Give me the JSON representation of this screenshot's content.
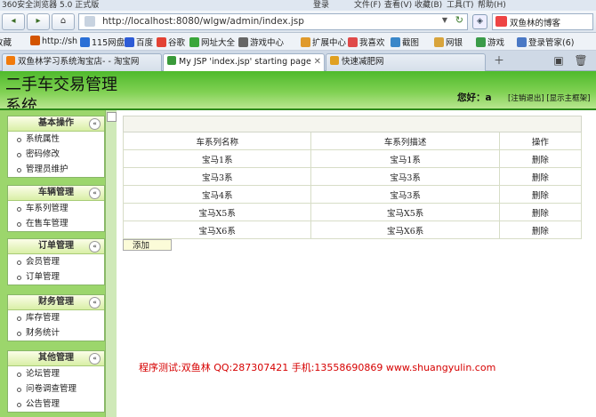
{
  "browser": {
    "window_title": "360安全浏览器 5.0 正式版",
    "menu": [
      "登录",
      "文件(F)",
      "查看(V)",
      "收藏(B)",
      "工具(T)",
      "帮助(H)"
    ],
    "address": "http://localhost:8080/wlgw/admin/index.jsp",
    "search_label": "双鱼林的博客",
    "nav": {
      "back": "◂",
      "forward": "▸",
      "home": "⌂"
    },
    "favorites": [
      {
        "label": "收藏",
        "color": "#e8b030"
      },
      {
        "label": "http://sh",
        "color": "#d35400"
      },
      {
        "label": "115网盘",
        "color": "#2a6fd6"
      },
      {
        "label": "百度",
        "color": "#2d5bd6"
      },
      {
        "label": "谷歌",
        "color": "#e34234"
      },
      {
        "label": "网址大全",
        "color": "#3aa63a"
      },
      {
        "label": "游戏中心",
        "color": "#666"
      },
      {
        "label": "扩展中心",
        "color": "#e09a2c"
      },
      {
        "label": "我喜欢",
        "color": "#e04a4a"
      },
      {
        "label": "截图",
        "color": "#3a87c9"
      },
      {
        "label": "网银",
        "color": "#d8a43c"
      },
      {
        "label": "游戏",
        "color": "#3b9b49"
      },
      {
        "label": "登录管家(6)",
        "color": "#4a78c5"
      }
    ],
    "tabs": [
      {
        "label": "双鱼林学习系统淘宝店- - 淘宝网",
        "color": "#f17a0b",
        "active": false
      },
      {
        "label": "My JSP 'index.jsp' starting page",
        "color": "#3a9a3a",
        "active": true
      },
      {
        "label": "快速减肥网",
        "color": "#e0a020",
        "active": false
      }
    ]
  },
  "header": {
    "title": "二手车交易管理系统",
    "greeting": "您好：a",
    "links": "[注销退出] [显示主框架]"
  },
  "sidebar": {
    "groups": [
      {
        "title": "基本操作",
        "items": [
          "系统属性",
          "密码修改",
          "管理员维护"
        ]
      },
      {
        "title": "车辆管理",
        "items": [
          "车系列管理",
          "在售车管理"
        ]
      },
      {
        "title": "订单管理",
        "items": [
          "会员管理",
          "订单管理"
        ]
      },
      {
        "title": "财务管理",
        "items": [
          "库存管理",
          "财务统计"
        ]
      },
      {
        "title": "其他管理",
        "items": [
          "论坛管理",
          "问卷调查管理",
          "公告管理"
        ]
      }
    ]
  },
  "table": {
    "columns": [
      "车系列名称",
      "车系列描述",
      "操作"
    ],
    "rows": [
      [
        "宝马1系",
        "宝马1系",
        "删除"
      ],
      [
        "宝马3系",
        "宝马3系",
        "删除"
      ],
      [
        "宝马4系",
        "宝马3系",
        "删除"
      ],
      [
        "宝马X5系",
        "宝马X5系",
        "删除"
      ],
      [
        "宝马X6系",
        "宝马X6系",
        "删除"
      ]
    ]
  },
  "add_button": "添加",
  "footer_note": "程序测试:双鱼林 QQ:287307421 手机:13558690869 www.shuangyulin.com"
}
